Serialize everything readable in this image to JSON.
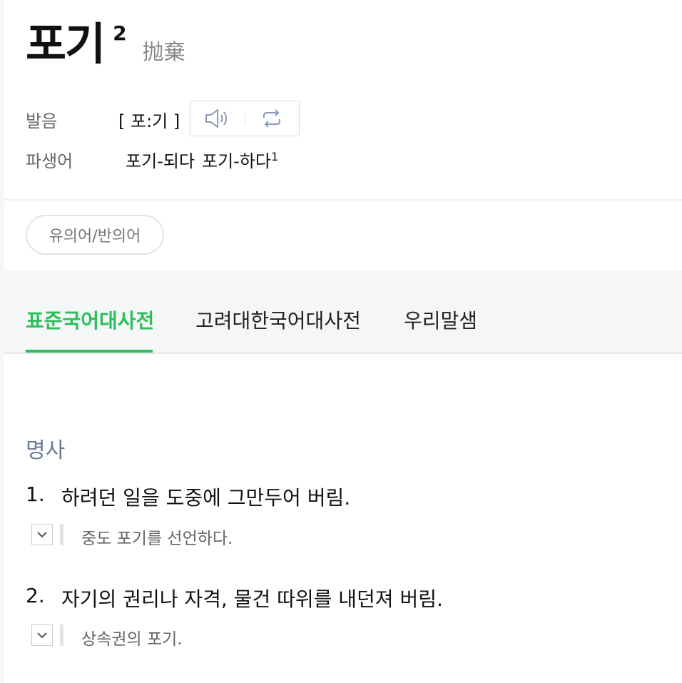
{
  "entry": {
    "word": "포기",
    "superscript": "2",
    "hanja": "抛棄"
  },
  "pronunciation": {
    "label": "발음",
    "value": "[ 포:기 ]",
    "icons": [
      "speaker-icon",
      "repeat-icon"
    ]
  },
  "derived": {
    "label": "파생어",
    "items": [
      {
        "text": "포기-되다",
        "sup": ""
      },
      {
        "text": "포기-하다",
        "sup": "1"
      }
    ]
  },
  "synonym_button": "유의어/반의어",
  "tabs": [
    {
      "label": "표준국어대사전",
      "active": true
    },
    {
      "label": "고려대한국어대사전",
      "active": false
    },
    {
      "label": "우리말샘",
      "active": false
    }
  ],
  "part_of_speech": "명사",
  "senses": [
    {
      "num": "1.",
      "text": "하려던 일을 도중에 그만두어 버림.",
      "example": "중도 포기를 선언하다."
    },
    {
      "num": "2.",
      "text": "자기의 권리나 자격, 물건 따위를 내던져 버림.",
      "example": "상속권의 포기."
    }
  ],
  "colors": {
    "accent": "#2ebe5a",
    "pos": "#6b7c99"
  }
}
